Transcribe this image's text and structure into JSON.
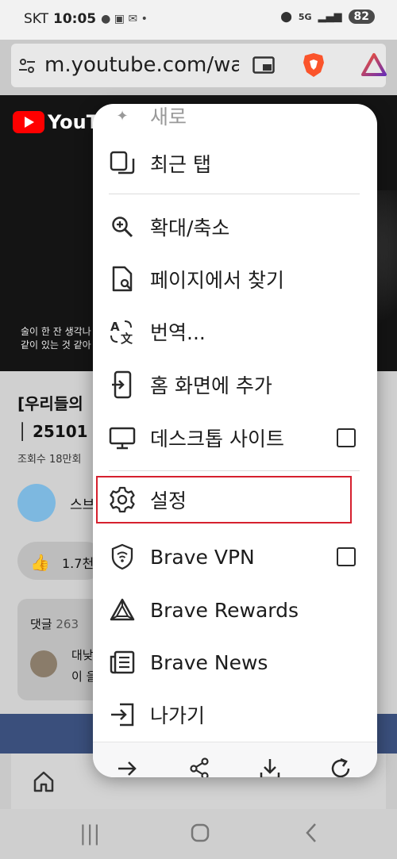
{
  "status": {
    "carrier": "SKT",
    "time": "10:05",
    "battery": "82",
    "network": "5G"
  },
  "urlbar": {
    "url": "m.youtube.com/wa"
  },
  "background_page": {
    "logo_text": "YouTube",
    "caption_line1": "술이 한 잔 생각나",
    "caption_line2": "같이 있는 것 같아",
    "title_line1": "[우리들의",
    "title_line2": "│ 25101",
    "views": "조회수 18만회",
    "channel": "스브",
    "likes": "1.7천",
    "comments_label": "댓글",
    "comments_count": "263",
    "comment_line1": "대낮",
    "comment_line2": "이 을"
  },
  "menu": {
    "partial_top_label": "새로",
    "items": [
      {
        "label": "최근 탭",
        "icon": "recent-tabs-icon"
      },
      {
        "label": "확대/축소",
        "icon": "zoom-icon"
      },
      {
        "label": "페이지에서 찾기",
        "icon": "find-in-page-icon"
      },
      {
        "label": "번역...",
        "icon": "translate-icon"
      },
      {
        "label": "홈 화면에 추가",
        "icon": "add-to-home-icon"
      },
      {
        "label": "데스크톱 사이트",
        "icon": "desktop-icon",
        "checkbox": false
      },
      {
        "label": "설정",
        "icon": "gear-icon"
      },
      {
        "label": "Brave VPN",
        "icon": "vpn-icon",
        "checkbox": false
      },
      {
        "label": "Brave Rewards",
        "icon": "rewards-icon"
      },
      {
        "label": "Brave News",
        "icon": "news-icon"
      },
      {
        "label": "나가기",
        "icon": "exit-icon"
      }
    ],
    "bottom_bar": [
      "forward-icon",
      "share-icon",
      "download-icon",
      "reload-icon"
    ]
  },
  "colors": {
    "highlight": "#d6202e",
    "brave_orange": "#fb542b",
    "brave_purple": "#6b2fb3"
  }
}
